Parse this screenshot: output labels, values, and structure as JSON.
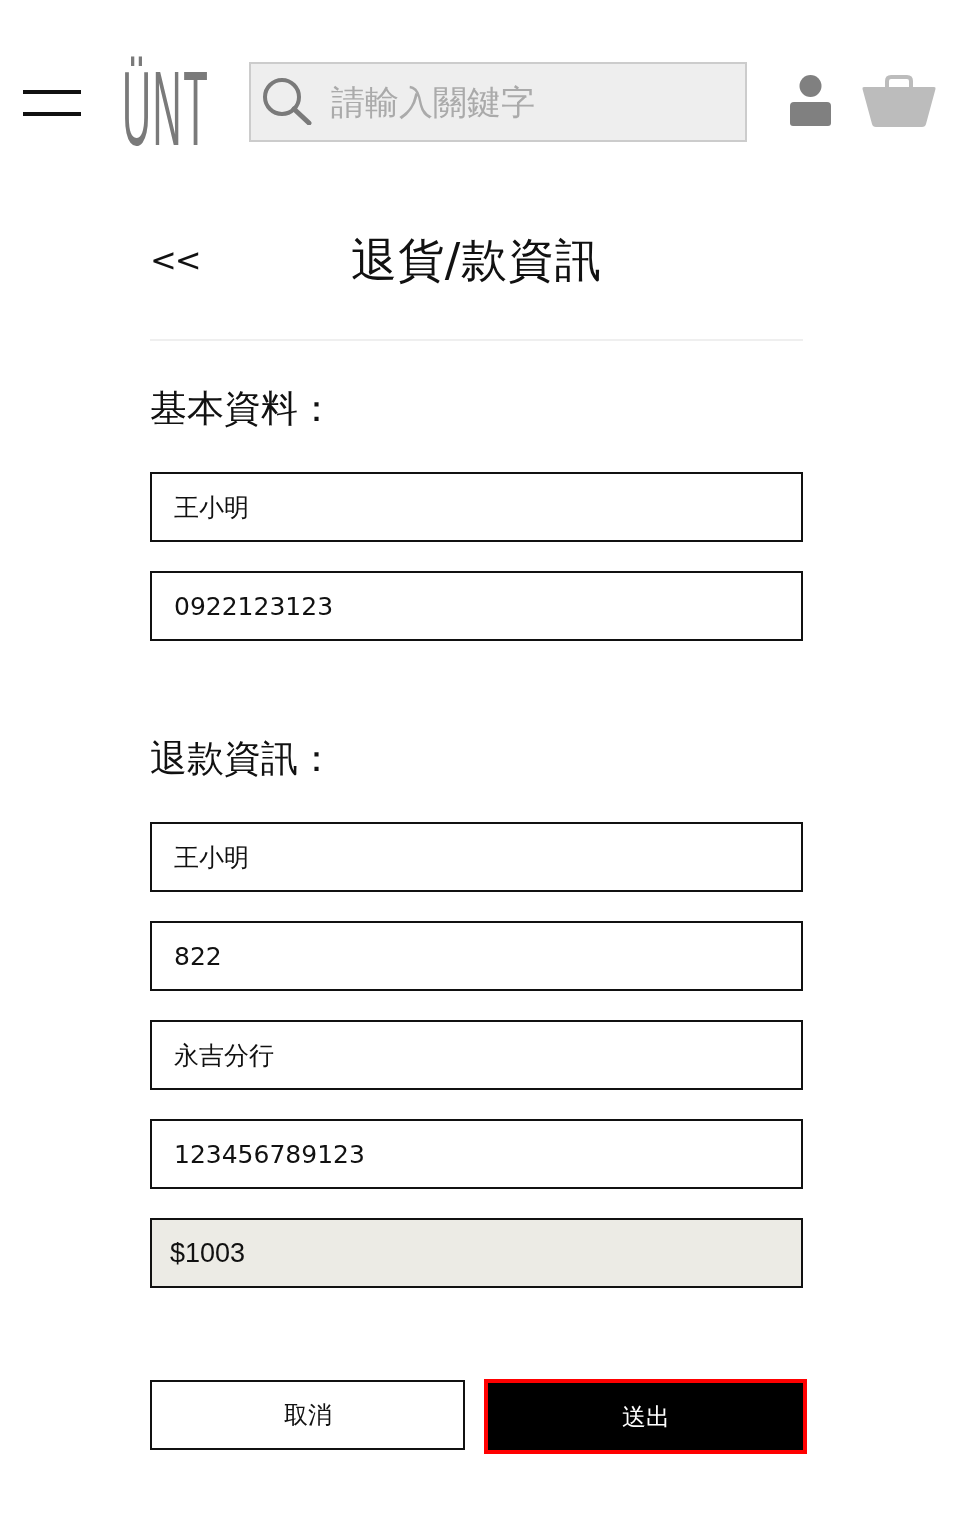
{
  "header": {
    "logo": "ÜNT",
    "search": {
      "placeholder": "請輸入關鍵字"
    }
  },
  "page": {
    "back": "<<",
    "title": "退貨/款資訊"
  },
  "sections": [
    {
      "heading": "基本資料：",
      "fields": [
        {
          "value": "王小明",
          "disabled": false
        },
        {
          "value": "0922123123",
          "disabled": false
        }
      ]
    },
    {
      "heading": "退款資訊：",
      "fields": [
        {
          "value": "王小明",
          "disabled": false
        },
        {
          "value": "822",
          "disabled": false
        },
        {
          "value": "永吉分行",
          "disabled": false
        },
        {
          "value": "123456789123",
          "disabled": false
        },
        {
          "value": "$1003",
          "disabled": true
        }
      ]
    }
  ],
  "buttons": [
    {
      "label": "取消",
      "kind": "secondary",
      "highlighted": false
    },
    {
      "label": "送出",
      "kind": "primary",
      "highlighted": true
    }
  ]
}
